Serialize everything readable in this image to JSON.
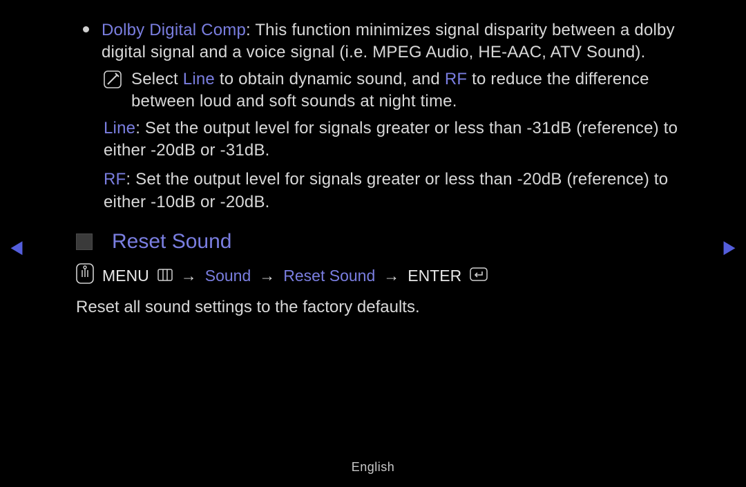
{
  "dolby": {
    "title": "Dolby Digital Comp",
    "desc": ": This function minimizes signal disparity between a dolby digital signal and a voice signal (i.e. MPEG Audio, HE-AAC, ATV Sound).",
    "note_pre": "Select ",
    "note_line_kw": "Line",
    "note_mid": " to obtain dynamic sound, and ",
    "note_rf_kw": "RF",
    "note_post": " to reduce the difference between loud and soft sounds at night time.",
    "line_kw": "Line",
    "line_desc": ": Set the output level for signals greater or less than -31dB (reference) to either -20dB or -31dB.",
    "rf_kw": "RF",
    "rf_desc": ": Set the output level for signals greater or less than -20dB (reference) to either -10dB or -20dB."
  },
  "reset": {
    "title": "Reset Sound",
    "menu_label": "MENU",
    "arrow": "→",
    "path1": "Sound",
    "path2": "Reset Sound",
    "enter_label": "ENTER",
    "desc": "Reset all sound settings to the factory defaults."
  },
  "footer": {
    "lang": "English"
  },
  "nav": {
    "left": "◀",
    "right": "▶"
  }
}
